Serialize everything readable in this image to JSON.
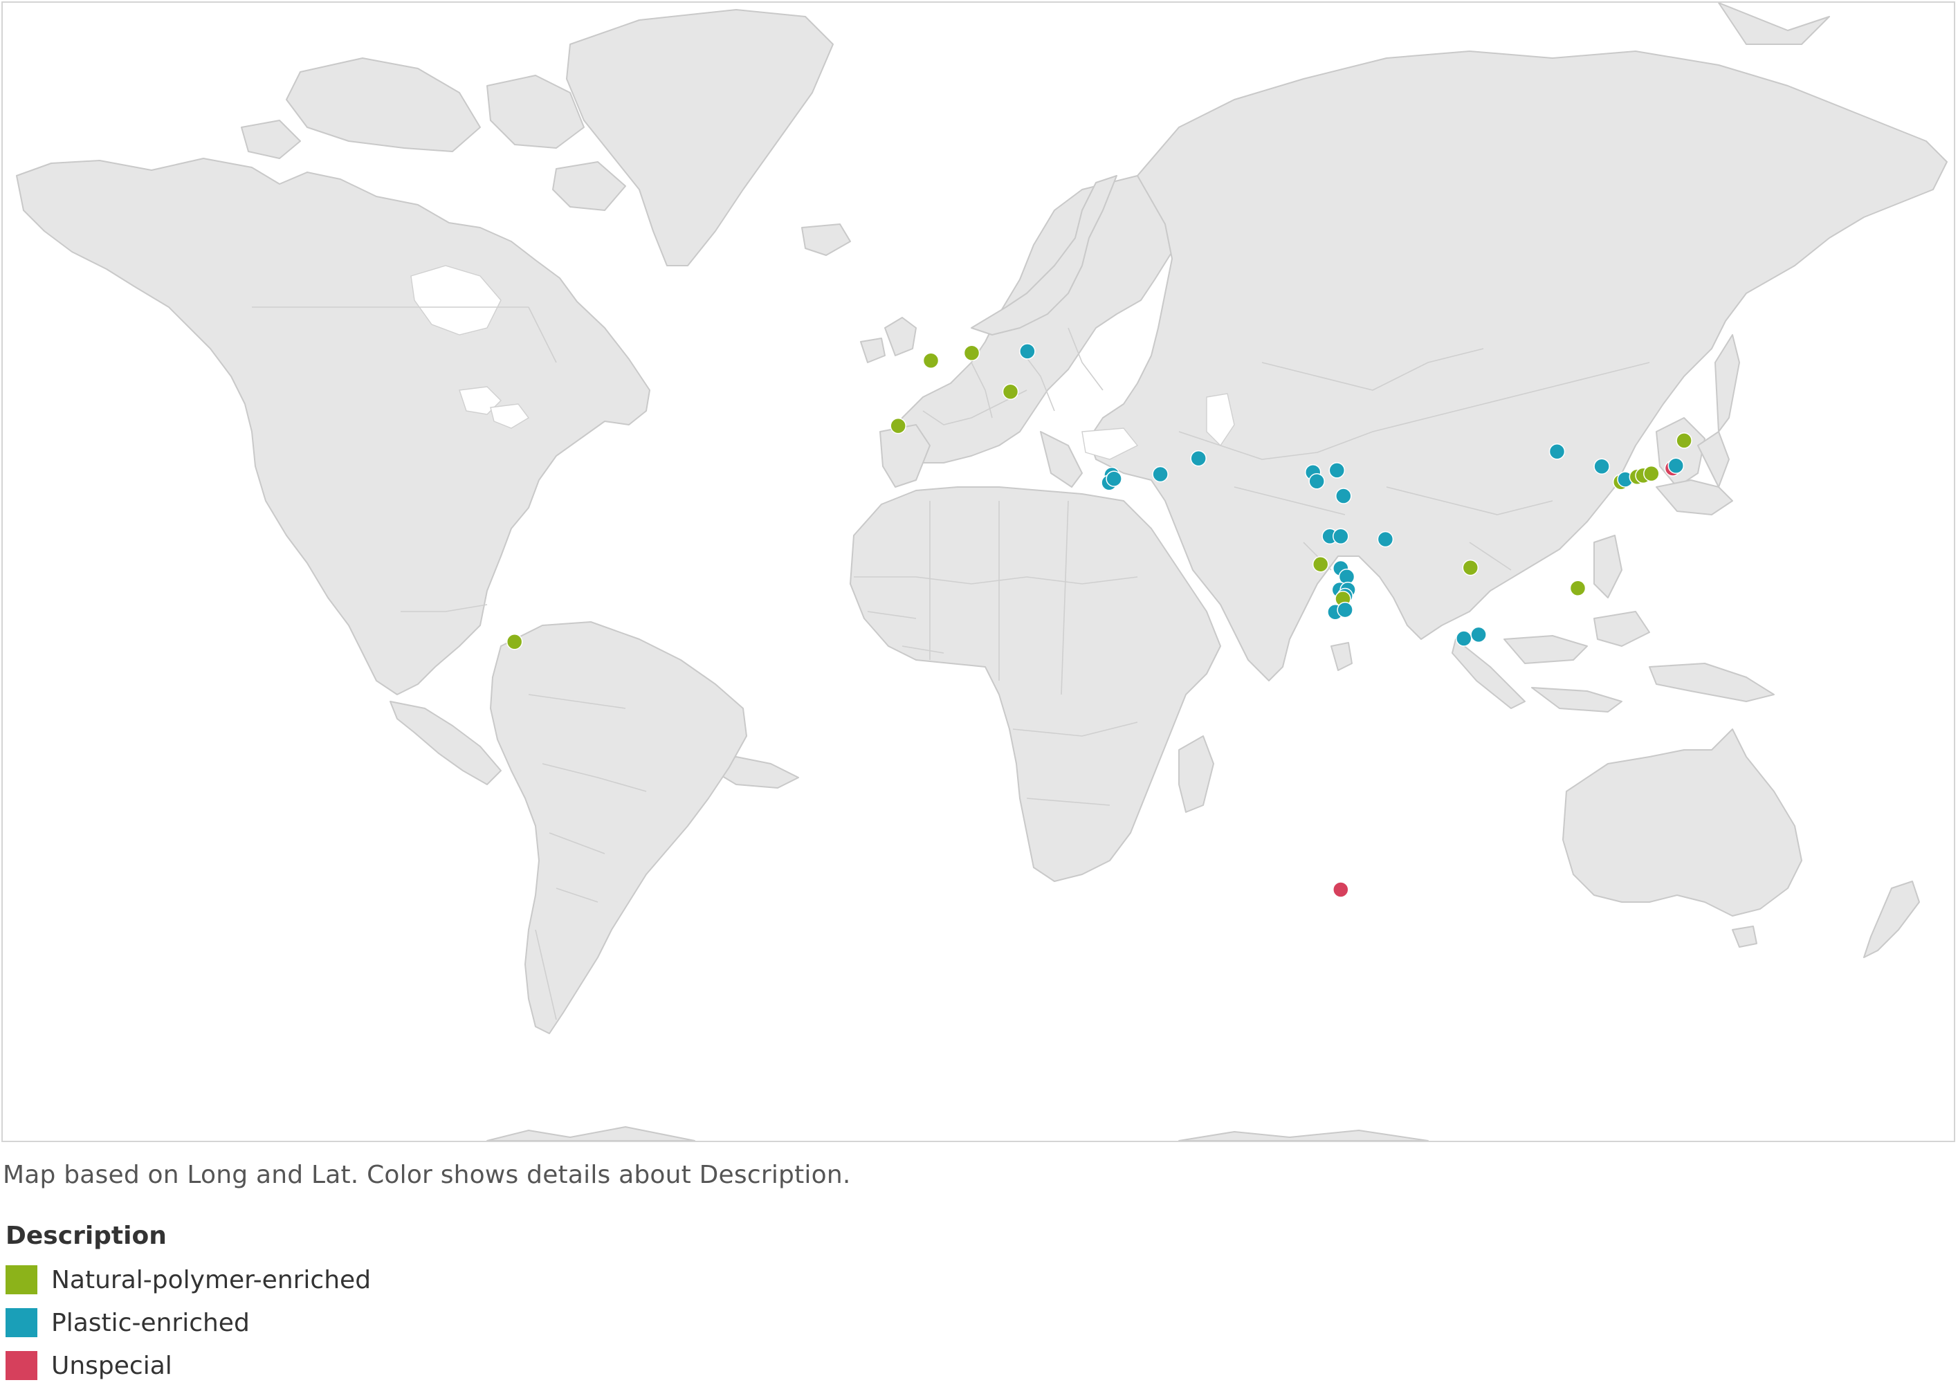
{
  "map": {
    "caption": "Map based on Long and Lat.  Color shows details about Description.",
    "projection": "web-mercator",
    "land_color": "#e6e6e6",
    "ocean_color": "#ffffff"
  },
  "legend": {
    "title": "Description",
    "items": [
      {
        "label": "Natural-polymer-enriched",
        "color": "#8cb31a"
      },
      {
        "label": "Plastic-enriched",
        "color": "#1a9fb8"
      },
      {
        "label": "Unspecial",
        "color": "#d6405c"
      }
    ]
  },
  "sites": [
    {
      "lon": 2.3,
      "lat": 48.9,
      "category": "Natural-polymer-enriched"
    },
    {
      "lon": 9.8,
      "lat": 49.8,
      "category": "Natural-polymer-enriched"
    },
    {
      "lon": 20.0,
      "lat": 50.0,
      "category": "Plastic-enriched"
    },
    {
      "lon": 16.9,
      "lat": 45.0,
      "category": "Natural-polymer-enriched"
    },
    {
      "lon": -3.7,
      "lat": 40.4,
      "category": "Natural-polymer-enriched"
    },
    {
      "lon": -74.1,
      "lat": 4.6,
      "category": "Natural-polymer-enriched"
    },
    {
      "lon": 35.5,
      "lat": 33.2,
      "category": "Plastic-enriched"
    },
    {
      "lon": 35.0,
      "lat": 32.0,
      "category": "Plastic-enriched"
    },
    {
      "lon": 35.9,
      "lat": 32.6,
      "category": "Plastic-enriched"
    },
    {
      "lon": 44.4,
      "lat": 33.3,
      "category": "Plastic-enriched"
    },
    {
      "lon": 51.4,
      "lat": 35.7,
      "category": "Plastic-enriched"
    },
    {
      "lon": 72.4,
      "lat": 33.6,
      "category": "Plastic-enriched"
    },
    {
      "lon": 73.1,
      "lat": 32.2,
      "category": "Plastic-enriched"
    },
    {
      "lon": 76.8,
      "lat": 33.9,
      "category": "Plastic-enriched"
    },
    {
      "lon": 78.0,
      "lat": 29.9,
      "category": "Plastic-enriched"
    },
    {
      "lon": 75.5,
      "lat": 23.3,
      "category": "Plastic-enriched"
    },
    {
      "lon": 77.5,
      "lat": 23.3,
      "category": "Plastic-enriched"
    },
    {
      "lon": 73.8,
      "lat": 18.5,
      "category": "Natural-polymer-enriched"
    },
    {
      "lon": 77.5,
      "lat": 17.8,
      "category": "Plastic-enriched"
    },
    {
      "lon": 78.6,
      "lat": 16.3,
      "category": "Plastic-enriched"
    },
    {
      "lon": 77.3,
      "lat": 14.0,
      "category": "Plastic-enriched"
    },
    {
      "lon": 78.8,
      "lat": 14.0,
      "category": "Plastic-enriched"
    },
    {
      "lon": 78.3,
      "lat": 12.9,
      "category": "Plastic-enriched"
    },
    {
      "lon": 77.9,
      "lat": 12.4,
      "category": "Natural-polymer-enriched"
    },
    {
      "lon": 76.5,
      "lat": 10.0,
      "category": "Plastic-enriched"
    },
    {
      "lon": 78.3,
      "lat": 10.4,
      "category": "Plastic-enriched"
    },
    {
      "lon": 85.7,
      "lat": 22.8,
      "category": "Plastic-enriched"
    },
    {
      "lon": 101.3,
      "lat": 17.9,
      "category": "Natural-polymer-enriched"
    },
    {
      "lon": 100.1,
      "lat": 5.2,
      "category": "Plastic-enriched"
    },
    {
      "lon": 102.8,
      "lat": 5.9,
      "category": "Plastic-enriched"
    },
    {
      "lon": 121.0,
      "lat": 14.3,
      "category": "Natural-polymer-enriched"
    },
    {
      "lon": 117.2,
      "lat": 36.7,
      "category": "Plastic-enriched"
    },
    {
      "lon": 125.4,
      "lat": 34.5,
      "category": "Plastic-enriched"
    },
    {
      "lon": 128.9,
      "lat": 32.1,
      "category": "Natural-polymer-enriched"
    },
    {
      "lon": 129.7,
      "lat": 32.5,
      "category": "Plastic-enriched"
    },
    {
      "lon": 131.9,
      "lat": 32.9,
      "category": "Natural-polymer-enriched"
    },
    {
      "lon": 133.0,
      "lat": 33.1,
      "category": "Natural-polymer-enriched"
    },
    {
      "lon": 134.5,
      "lat": 33.4,
      "category": "Natural-polymer-enriched"
    },
    {
      "lon": 138.4,
      "lat": 34.2,
      "category": "Unspecial"
    },
    {
      "lon": 139.0,
      "lat": 34.6,
      "category": "Plastic-enriched"
    },
    {
      "lon": 140.5,
      "lat": 38.3,
      "category": "Natural-polymer-enriched"
    },
    {
      "lon": 77.5,
      "lat": -37.8,
      "category": "Unspecial"
    }
  ]
}
